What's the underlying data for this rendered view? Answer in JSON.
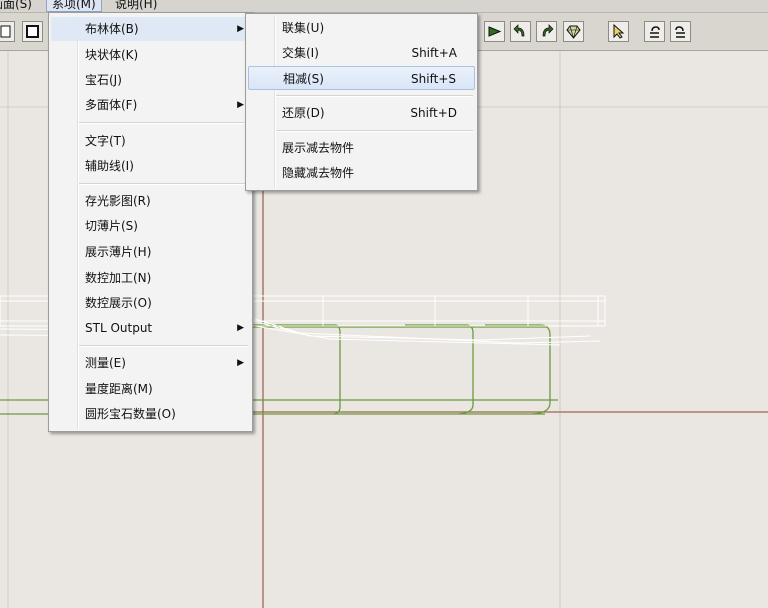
{
  "menubar": {
    "items": [
      {
        "label": "画面(S)"
      },
      {
        "label": "系项(M)"
      },
      {
        "label": "说明(H)"
      }
    ]
  },
  "toolbar": {
    "buttons": [
      {
        "icon": "new-doc-icon"
      },
      {
        "icon": "square-icon"
      },
      {
        "icon": "play-arrow-icon"
      },
      {
        "icon": "rotate-left-icon"
      },
      {
        "icon": "rotate-right-icon"
      },
      {
        "icon": "gem-icon"
      },
      {
        "icon": "select-pointer-icon"
      },
      {
        "icon": "undo-icon"
      },
      {
        "icon": "redo-icon"
      }
    ]
  },
  "main_menu": {
    "groups": [
      [
        {
          "label": "布林体(B)",
          "submenu": true
        },
        {
          "label": "块状体(K)"
        },
        {
          "label": "宝石(J)"
        },
        {
          "label": "多面体(F)",
          "submenu": true
        }
      ],
      [
        {
          "label": "文字(T)"
        },
        {
          "label": "辅助线(I)"
        }
      ],
      [
        {
          "label": "存光影图(R)"
        },
        {
          "label": "切薄片(S)"
        },
        {
          "label": "展示薄片(H)"
        },
        {
          "label": "数控加工(N)"
        },
        {
          "label": "数控展示(O)"
        },
        {
          "label": "STL Output",
          "submenu": true
        }
      ],
      [
        {
          "label": "测量(E)",
          "submenu": true
        },
        {
          "label": "量度距离(M)"
        },
        {
          "label": "圆形宝石数量(O)"
        }
      ]
    ]
  },
  "boolean_submenu": {
    "items": [
      {
        "label": "联集(U)",
        "shortcut": ""
      },
      {
        "label": "交集(I)",
        "shortcut": "Shift+A"
      },
      {
        "label": "相减(S)",
        "shortcut": "Shift+S"
      },
      {
        "label": "还原(D)",
        "shortcut": "Shift+D"
      },
      {
        "label": "展示减去物件",
        "shortcut": ""
      },
      {
        "label": "隐藏减去物件",
        "shortcut": ""
      }
    ],
    "highlighted": "相减(S)"
  },
  "colors": {
    "menu_highlight": "#dde8f6",
    "grid_major": "#c9c4bc",
    "axis_line": "#9b6a4e",
    "model_green": "#6d9a3f",
    "model_white": "#ffffff"
  }
}
